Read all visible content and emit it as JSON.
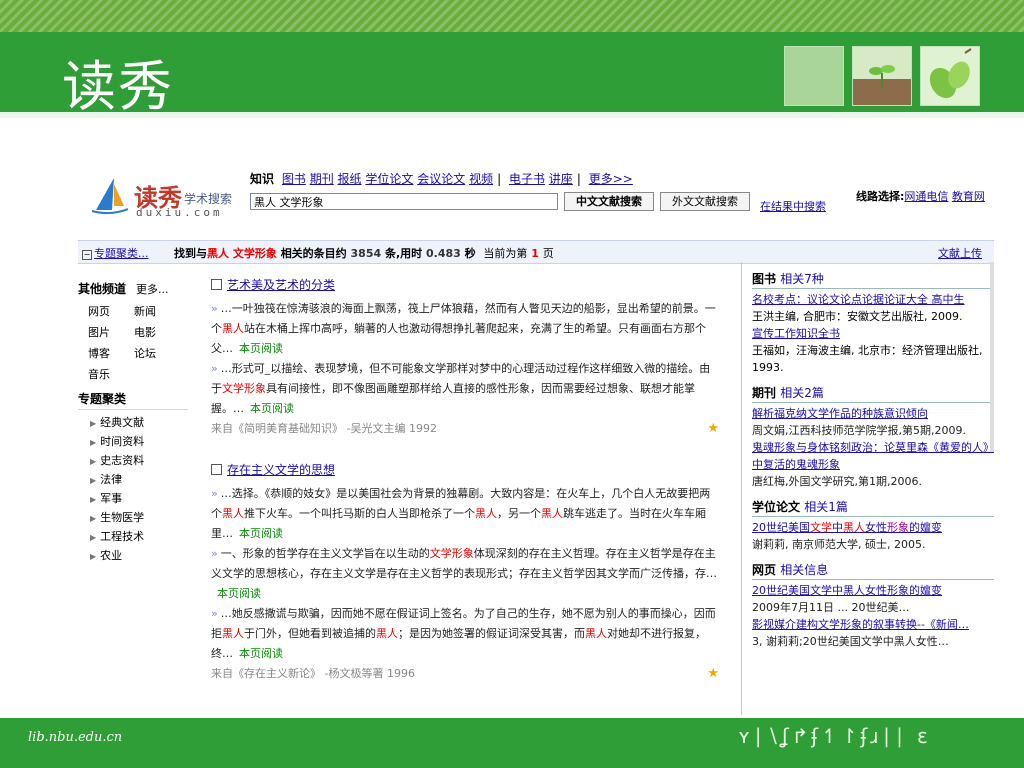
{
  "slide": {
    "title": "读秀",
    "footer_url": "lib.nbu.edu.cn",
    "footer_decoration": "ʏ∣∖ʆ↱ʄ↿↾ʄɹ∣∣ ɛ",
    "colors": {
      "green": "#2f9e36",
      "light_green": "#6aad3a"
    }
  },
  "logo": {
    "cn": "读秀",
    "cn_sub": "学术搜索",
    "en": "duxiu.com"
  },
  "categories": {
    "current": "知识",
    "items": [
      "图书",
      "期刊",
      "报纸",
      "学位论文",
      "会议论文",
      "视频"
    ],
    "items2": [
      "电子书",
      "讲座"
    ],
    "more": "更多>>",
    "sep": "|"
  },
  "search": {
    "query": "黑人 文学形象",
    "btn_cn": "中文文献搜索",
    "btn_foreign": "外文文献搜索",
    "within": "在结果中搜索"
  },
  "route": {
    "label": "线路选择:",
    "opt1": "网通电信",
    "opt2": "教育网"
  },
  "result_bar": {
    "toggle": "专题聚类...",
    "pre": "找到与",
    "kw1": "黑人",
    "kw2": "文学形象",
    "mid": "相关的条目约",
    "count": "3854",
    "time_label": "条,用时",
    "time": "0.483",
    "sec": "秒",
    "page_pre": "当前为第",
    "page": "1",
    "page_post": "页",
    "upload": "文献上传"
  },
  "sidebar": {
    "other_title": "其他频道",
    "more": "更多...",
    "channels": [
      "网页",
      "新闻",
      "图片",
      "电影",
      "博客",
      "论坛",
      "音乐"
    ],
    "topics_title": "专题聚类",
    "topics": [
      "经典文献",
      "时间资料",
      "史志资料",
      "法律",
      "军事",
      "生物医学",
      "工程技术",
      "农业"
    ]
  },
  "results": [
    {
      "title": "艺术美及艺术的分类",
      "snippets": [
        {
          "parts": [
            "…一叶独筏在惊涛骇浪的海面上飘荡，筏上尸体狼藉，然而有人瞥见天边的船影，显出希望的前景。一个",
            "黑人",
            "站在木桶上挥巾高呼，躺著的人也激动得想挣扎著爬起来，充满了生的希望。只有画面右方那个父…"
          ],
          "read": "本页阅读"
        },
        {
          "parts": [
            "…形式可_以描绘、表现梦境，但不可能象文学那样对梦中的心理活动过程作这样细致入微的描绘。由于",
            "文学形象",
            "具有间接性，即不像图画雕塑那样给人直接的感性形象，因而需要经过想象、联想才能掌握。…"
          ],
          "read": "本页阅读"
        }
      ],
      "source": "来自《简明美育基础知识》 -吴光文主编 1992"
    },
    {
      "title": "存在主义文学的思想",
      "snippets": [
        {
          "parts": [
            "…选择。《恭顺的妓女》是以美国社会为背景的独幕剧。大致内容是：在火车上，几个白人无故要把两个",
            "黑人",
            "推下火车。一个叫托马斯的白人当即枪杀了一个",
            "黑人",
            "，另一个",
            "黑人",
            "跳车逃走了。当时在火车车厢里…"
          ],
          "read": "本页阅读"
        },
        {
          "parts": [
            "一、形象的哲学存在主义文学旨在以生动的",
            "文学形象",
            "体现深刻的存在主义哲理。存在主义哲学是存在主义文学的思想核心，存在主义文学是存在主义哲学的表现形式；存在主义哲学因其文学而广泛传播，存…"
          ],
          "read": "本页阅读"
        },
        {
          "parts": [
            "…她反感撒谎与欺骗，因而她不愿在假证词上签名。为了自己的生存，她不愿为别人的事而操心，因而拒",
            "黑人",
            "于门外，但她看到被追捕的",
            "黑人",
            "；是因为她签署的假证词深受其害，而",
            "黑人",
            "对她却不进行报复，终…"
          ],
          "read": "本页阅读"
        }
      ],
      "source": "来自《存在主义新论》 -杨文极等著 1996"
    }
  ],
  "right_panel": {
    "books": {
      "title": "图书",
      "count": "相关7种",
      "entries": [
        {
          "link": "名校考点：议论文论点论据论证大全 高中生",
          "meta": "王洪主编, 合肥市：安徽文艺出版社, 2009."
        },
        {
          "link": "宣传工作知识全书",
          "meta": "王福如，汪海波主编, 北京市：经济管理出版社, 1993."
        }
      ]
    },
    "journals": {
      "title": "期刊",
      "count": "相关2篇",
      "entries": [
        {
          "link": "解析福克纳文学作品的种族意识倾向",
          "meta": "周文娟,江西科技师范学院学报,第5期,2009."
        },
        {
          "link": "鬼魂形象与身体铭刻政治：论莫里森《黄爱的人》中复活的鬼魂形象",
          "meta": "唐红梅,外国文学研究,第1期,2006."
        }
      ]
    },
    "theses": {
      "title": "学位论文",
      "count": "相关1篇",
      "entries": [
        {
          "parts": [
            "20世纪美国",
            "文学",
            "中",
            "黑人",
            "女性",
            "形象",
            "的嬗变"
          ],
          "meta": "谢莉莉, 南京师范大学, 硕士, 2005."
        }
      ]
    },
    "web": {
      "title": "网页",
      "count": "相关信息",
      "entries": [
        {
          "link": "20世纪美国文学中黑人女性形象的嬗变",
          "meta": "2009年7月11日 ... 20世纪美…"
        },
        {
          "link": "影视媒介建构文学形象的叙事转换--《新闻…",
          "meta": "3, 谢莉莉;20世纪美国文学中黑人女性…"
        }
      ]
    }
  }
}
